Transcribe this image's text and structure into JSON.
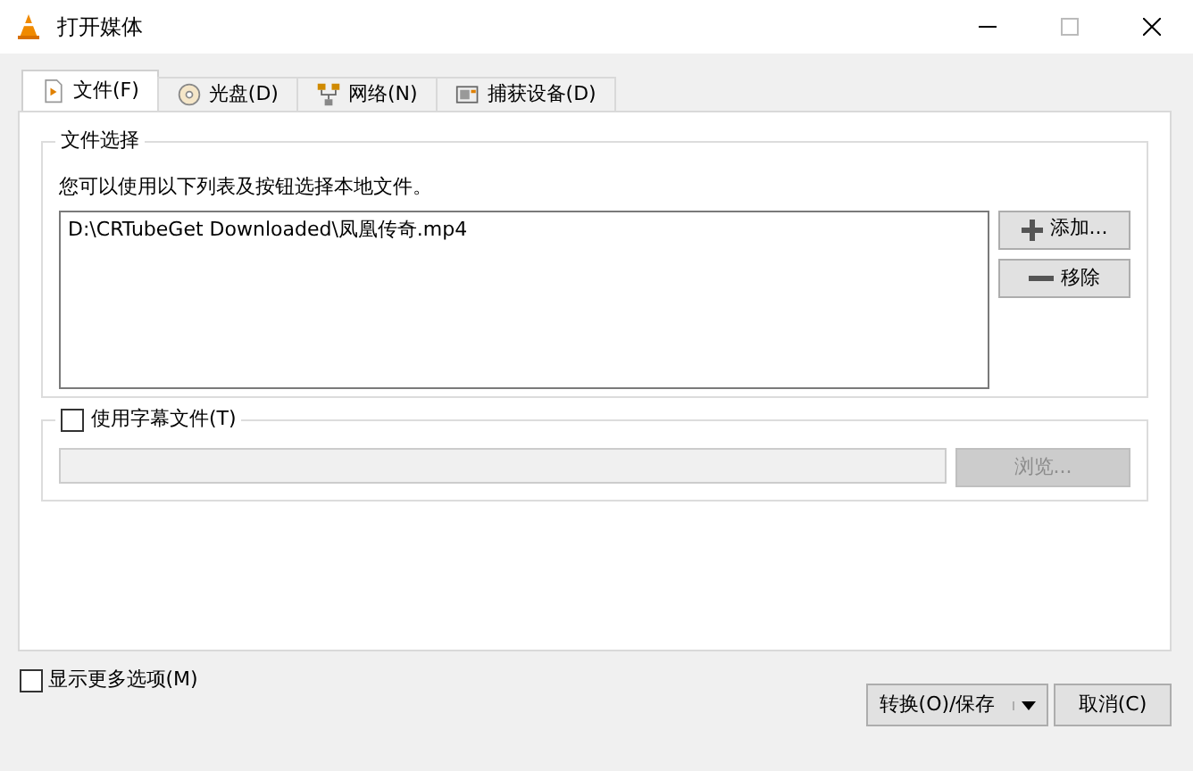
{
  "window": {
    "title": "打开媒体"
  },
  "tabs": [
    {
      "label": "文件(F)",
      "selected": true
    },
    {
      "label": "光盘(D)",
      "selected": false
    },
    {
      "label": "网络(N)",
      "selected": false
    },
    {
      "label": "捕获设备(D)",
      "selected": false
    }
  ],
  "file_selection": {
    "title": "文件选择",
    "description": "您可以使用以下列表及按钮选择本地文件。",
    "files": [
      "D:\\CRTubeGet Downloaded\\凤凰传奇.mp4"
    ],
    "buttons": [
      {
        "label": "添加..."
      },
      {
        "label": "移除"
      }
    ]
  },
  "subtitle": {
    "label": "使用字幕文件(T)",
    "checked": false,
    "browse": {
      "label": "浏览...",
      "disabled": true
    }
  },
  "show_more": {
    "label": "显示更多选项(M)",
    "checked": false
  },
  "footer_buttons": [
    {
      "label": "转换(O)/保存",
      "dropdown": true
    },
    {
      "label": "取消(C)",
      "dropdown": false
    }
  ]
}
